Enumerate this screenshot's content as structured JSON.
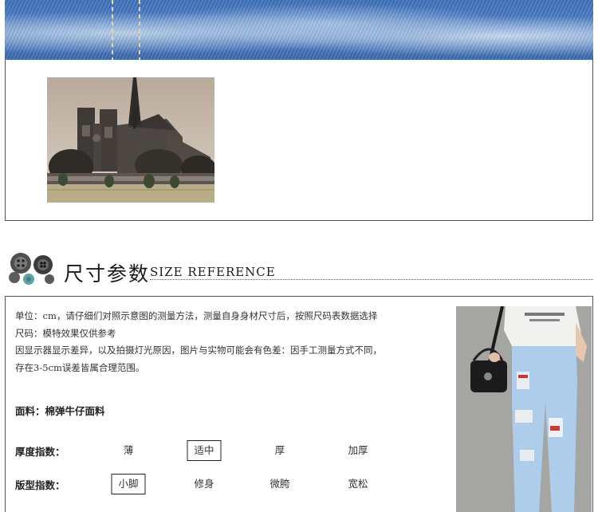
{
  "section_title": {
    "cn": "尺寸参数",
    "en": "SIZE REFERENCE"
  },
  "notes": [
    "单位：cm，请仔细们对照示意图的测量方法，测量自身身材尺寸后，按照尺码表数据选择",
    "尺码：模特效果仅供参考",
    "因显示器显示差异，以及拍摄灯光原因，图片与实物可能会有色差：因手工测量方式不同，",
    "存在3-5cm误差皆属合理范围。"
  ],
  "fabric": "面料：棉弹牛仔面料",
  "indices": [
    {
      "label": "厚度指数：",
      "options": [
        "薄",
        "适中",
        "厚",
        "加厚"
      ],
      "selected": "适中"
    },
    {
      "label": "版型指数：",
      "options": [
        "小脚",
        "修身",
        "微胯",
        "宽松"
      ],
      "selected": "小脚"
    }
  ],
  "icons": {
    "title_icon": "button-cluster-icon"
  }
}
